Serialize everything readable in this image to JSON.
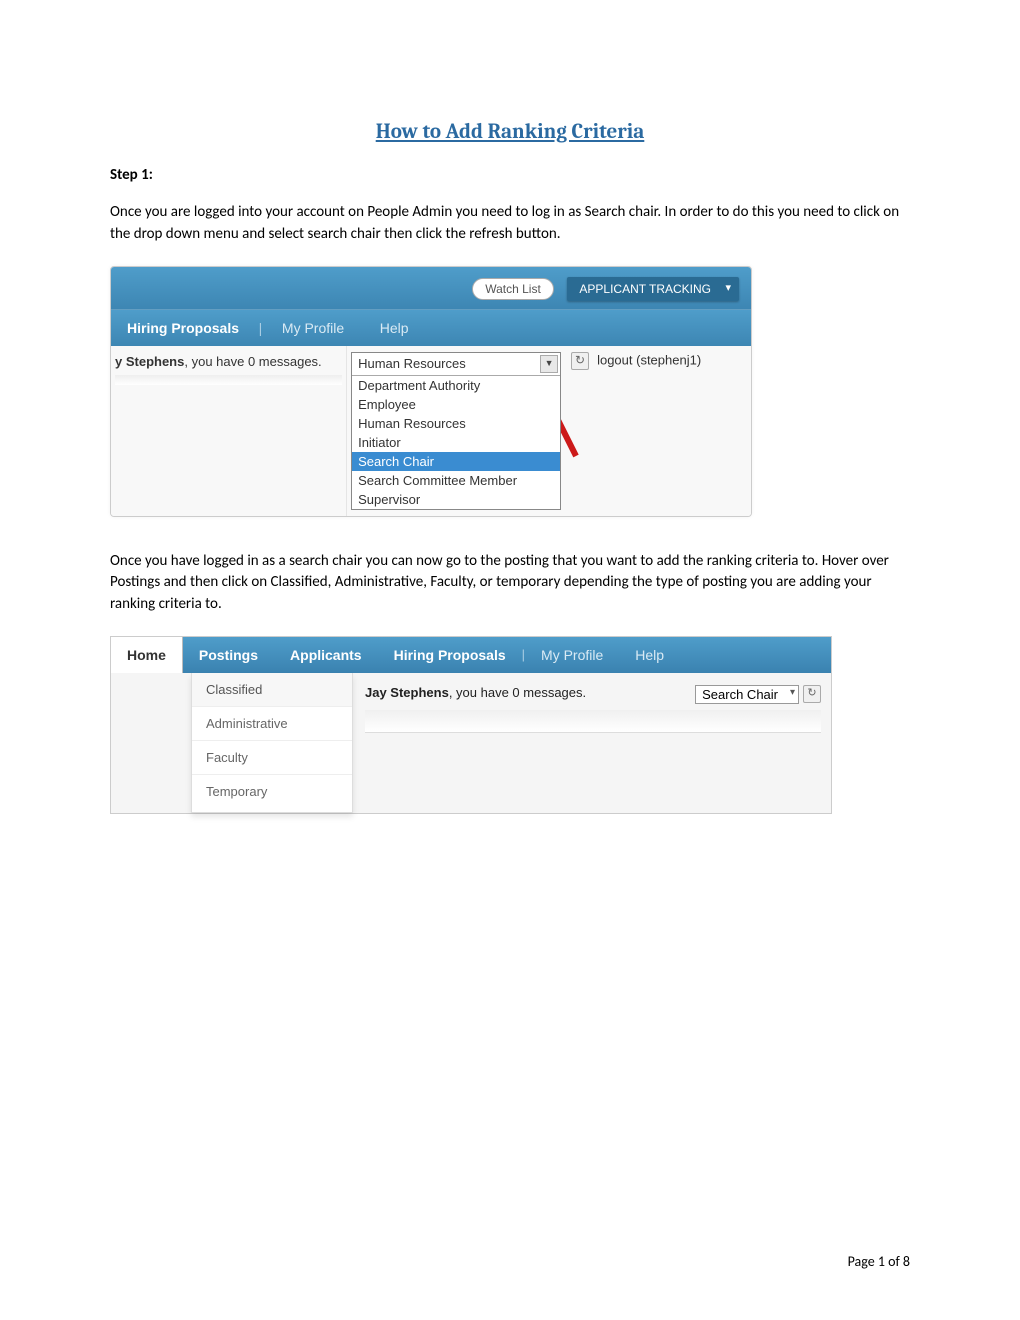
{
  "title": "How to Add Ranking Criteria",
  "step_label": "Step 1:",
  "para1": "Once you are logged into your account on People Admin you need to log in as Search chair.  In order to do this you need to click on the drop down menu and select search chair then click the refresh button.",
  "shot1": {
    "watch_list": "Watch List",
    "tracking": "APPLICANT TRACKING",
    "nav": {
      "hiring_proposals": "Hiring Proposals",
      "my_profile": "My Profile",
      "help": "Help"
    },
    "msg_prefix": "y Stephens",
    "msg_suffix": ", you have 0 messages.",
    "select_head": "Human Resources",
    "options": [
      "Department Authority",
      "Employee",
      "Human Resources",
      "Initiator",
      "Search Chair",
      "Search Committee Member",
      "Supervisor"
    ],
    "highlight_index": 4,
    "logout": "logout (stephenj1)"
  },
  "para2": "Once you have logged in as a search chair you can now go to the posting that you want to add the ranking criteria to.  Hover over Postings and then click on Classified, Administrative, Faculty, or temporary depending the type of posting you are adding your ranking criteria to.",
  "shot2": {
    "nav": {
      "home": "Home",
      "postings": "Postings",
      "applicants": "Applicants",
      "hiring_proposals": "Hiring Proposals",
      "my_profile": "My Profile",
      "help": "Help"
    },
    "menu": [
      "Classified",
      "Administrative",
      "Faculty",
      "Temporary"
    ],
    "msg_bold": "Jay Stephens",
    "msg_rest": ", you have 0 messages.",
    "select_value": "Search Chair"
  },
  "footer": "Page 1 of 8"
}
